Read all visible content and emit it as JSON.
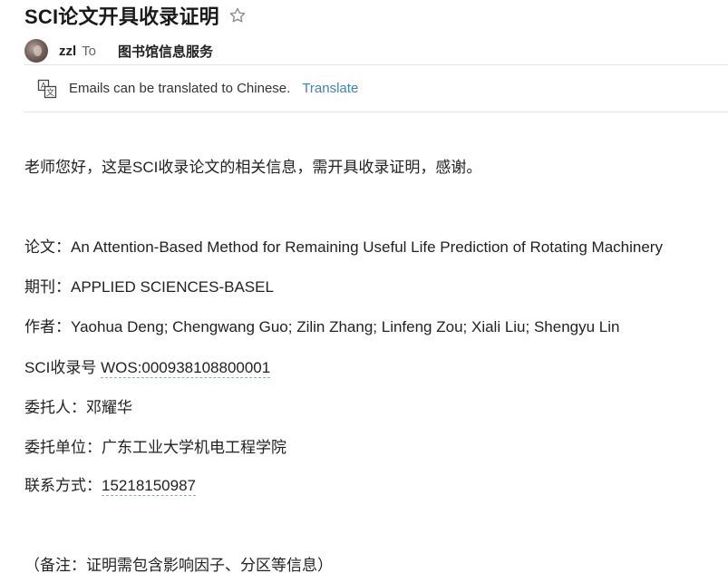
{
  "email": {
    "subject": "SCI论文开具收录证明",
    "sender": "zzl",
    "to_word": "To",
    "recipient": "图书馆信息服务"
  },
  "translate_bar": {
    "message": "Emails can be translated to Chinese.",
    "link": "Translate"
  },
  "body": {
    "greeting": "老师您好，这是SCI收录论文的相关信息，需开具收录证明，感谢。",
    "paper_label": "论文：",
    "paper_value": "An Attention-Based Method for Remaining Useful Life Prediction of Rotating Machinery",
    "journal_label": "期刊：",
    "journal_value": "APPLIED SCIENCES-BASEL",
    "authors_label": "作者：",
    "authors_value": "Yaohua Deng; Chengwang Guo; Zilin Zhang; Linfeng Zou; Xiali Liu; Shengyu Lin",
    "sci_label": "SCI收录号 ",
    "sci_value": "WOS:000938108800001",
    "client_label": "委托人：",
    "client_value": "邓耀华",
    "unit_label": "委托单位：",
    "unit_value": "广东工业大学机电工程学院",
    "contact_label": "联系方式：",
    "contact_value": "15218150987",
    "note": "（备注：证明需包含影响因子、分区等信息）"
  },
  "icons": {
    "star": "star-outline-icon",
    "translate": "translate-icon"
  },
  "colors": {
    "link": "#3b82c4",
    "divider": "#e3e3e3"
  }
}
